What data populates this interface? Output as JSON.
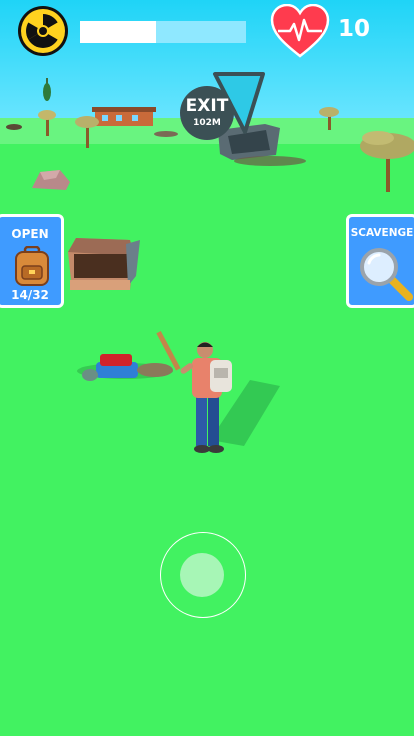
{
  "hud": {
    "radiation_icon": "radiation-icon",
    "progress_fraction": 0.46,
    "health_icon": "heart-icon",
    "health_value": "10"
  },
  "exit_marker": {
    "label": "EXIT",
    "distance": "102M"
  },
  "open_button": {
    "label": "OPEN",
    "icon": "backpack-icon",
    "count": "14/32"
  },
  "scavenge_button": {
    "label": "SCAVENGE",
    "icon": "magnifier-icon"
  },
  "colors": {
    "sky": "#1fd4f7",
    "ground": "#42f261",
    "button": "#3f9bff",
    "heart": "#ff3b4e"
  }
}
